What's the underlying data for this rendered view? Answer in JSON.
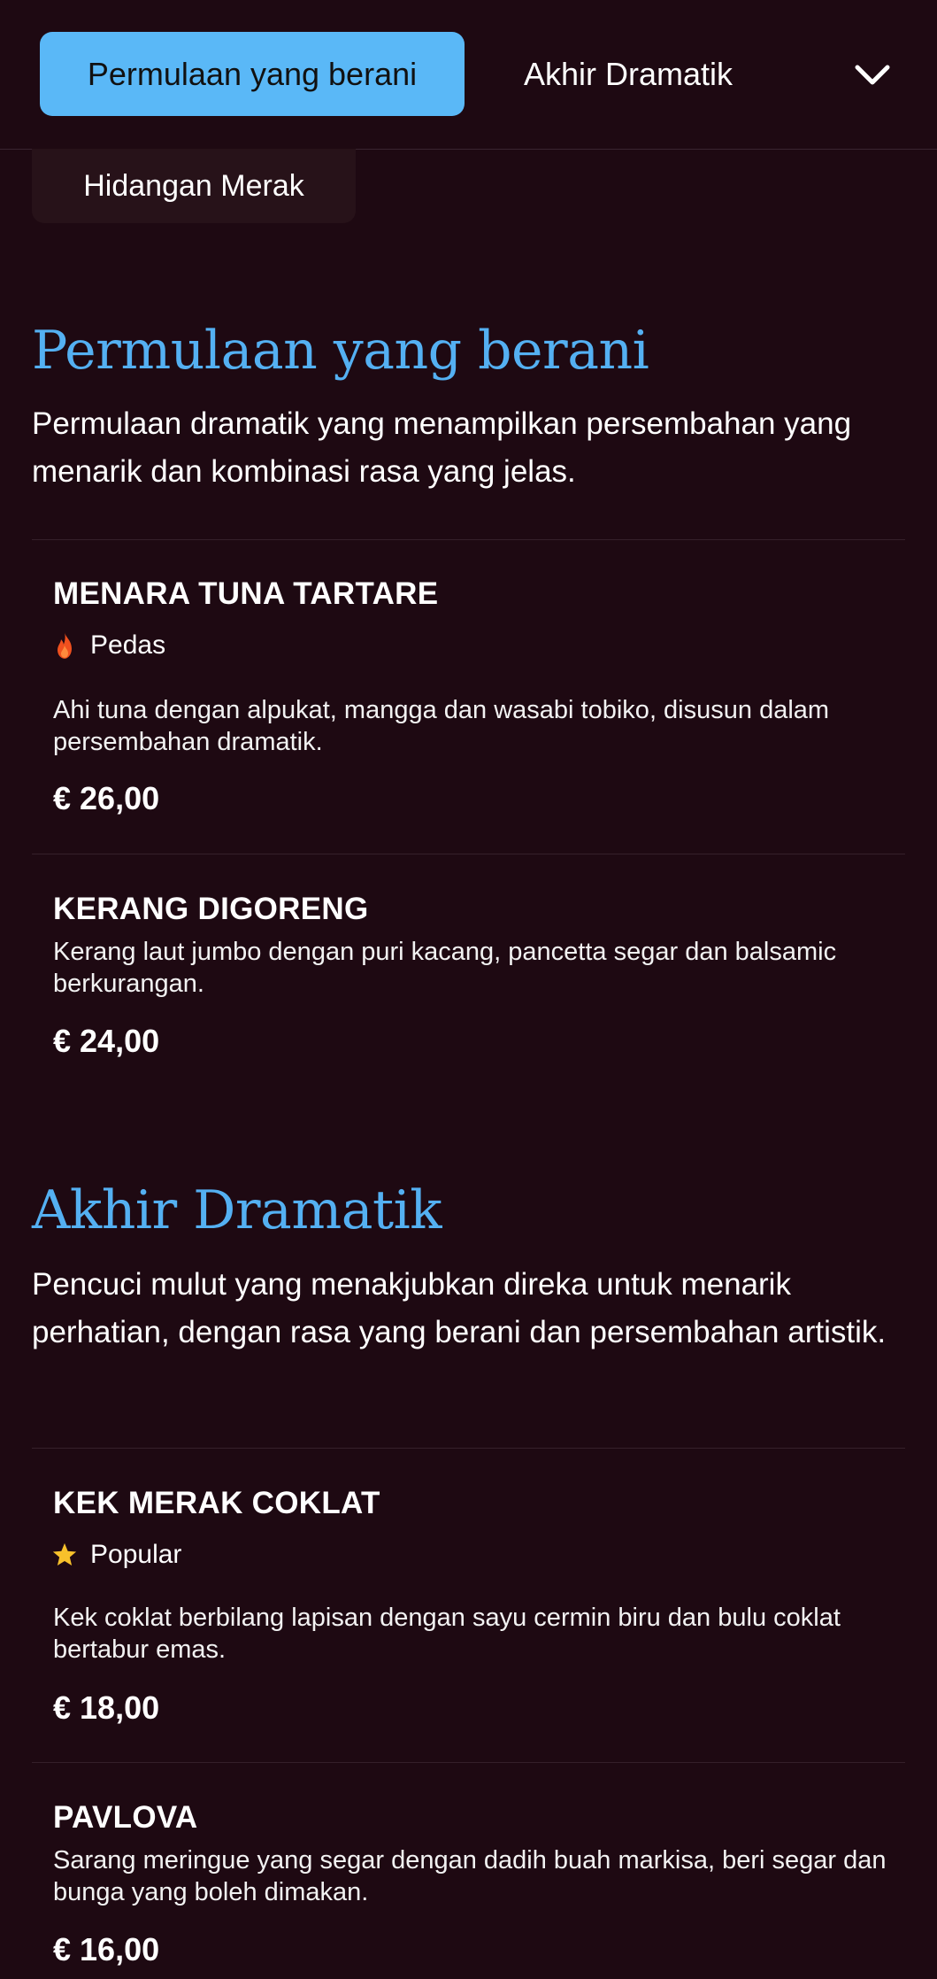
{
  "nav": {
    "active_tab": "Permulaan yang berani",
    "tab_2": "Akhir Dramatik",
    "more_icon": "chevron-down-icon",
    "sub_tab": "Hidangan Merak"
  },
  "colors": {
    "background": "#1e0912",
    "accent": "#5ab8f7",
    "title": "#54b0f2",
    "fire": "#f0501e",
    "star": "#f7c12b"
  },
  "sections": [
    {
      "title": "Permulaan yang berani",
      "description": "Permulaan dramatik yang menampilkan persembahan yang menarik dan kombinasi rasa yang jelas.",
      "items": [
        {
          "name": "MENARA TUNA TARTARE",
          "tag": "Pedas",
          "tag_icon": "fire-icon",
          "description": "Ahi tuna dengan alpukat, mangga dan wasabi tobiko, disusun dalam persembahan dramatik.",
          "price": "€ 26,00"
        },
        {
          "name": "KERANG DIGORENG",
          "description": "Kerang laut jumbo dengan puri kacang, pancetta segar dan balsamic berkurangan.",
          "price": "€ 24,00"
        }
      ]
    },
    {
      "title": "Akhir Dramatik",
      "description": "Pencuci mulut yang menakjubkan direka untuk menarik perhatian, dengan rasa yang berani dan persembahan artistik.",
      "items": [
        {
          "name": "KEK MERAK COKLAT",
          "tag": "Popular",
          "tag_icon": "star-icon",
          "description": "Kek coklat berbilang lapisan dengan sayu cermin biru dan bulu coklat bertabur emas.",
          "price": "€ 18,00"
        },
        {
          "name": "PAVLOVA",
          "description": "Sarang meringue yang segar dengan dadih buah markisa, beri segar dan bunga yang boleh dimakan.",
          "price": "€ 16,00"
        }
      ]
    }
  ]
}
